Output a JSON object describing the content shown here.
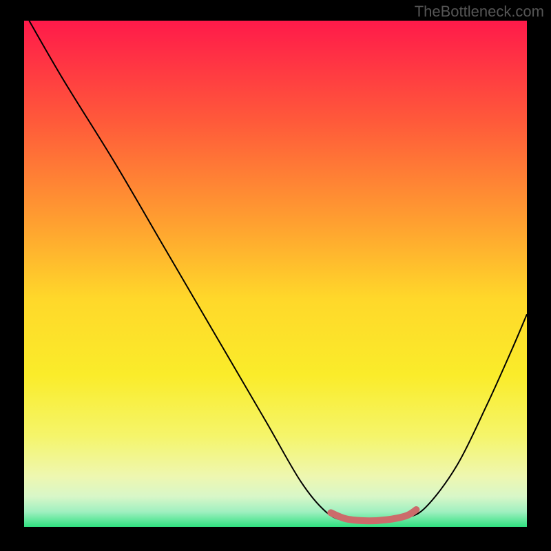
{
  "watermark": "TheBottleneck.com",
  "chart_data": {
    "type": "line",
    "title": "",
    "xlabel": "",
    "ylabel": "",
    "xlim": [
      0,
      100
    ],
    "ylim": [
      0,
      100
    ],
    "gradient_stops": [
      {
        "offset": 0,
        "color": "#ff1a4a"
      },
      {
        "offset": 20,
        "color": "#ff5a3a"
      },
      {
        "offset": 40,
        "color": "#ffa030"
      },
      {
        "offset": 55,
        "color": "#ffd82a"
      },
      {
        "offset": 70,
        "color": "#faec2a"
      },
      {
        "offset": 82,
        "color": "#f5f56a"
      },
      {
        "offset": 90,
        "color": "#eef7b0"
      },
      {
        "offset": 94,
        "color": "#d8f7c8"
      },
      {
        "offset": 97,
        "color": "#a0f0c0"
      },
      {
        "offset": 100,
        "color": "#30e080"
      }
    ],
    "series": [
      {
        "name": "bottleneck-curve",
        "color": "#000000",
        "width": 2,
        "points": [
          {
            "x": 1,
            "y": 100
          },
          {
            "x": 8,
            "y": 88
          },
          {
            "x": 18,
            "y": 72
          },
          {
            "x": 28,
            "y": 55
          },
          {
            "x": 38,
            "y": 38
          },
          {
            "x": 48,
            "y": 21
          },
          {
            "x": 55,
            "y": 9
          },
          {
            "x": 60,
            "y": 3
          },
          {
            "x": 64,
            "y": 1.2
          },
          {
            "x": 70,
            "y": 1.0
          },
          {
            "x": 76,
            "y": 1.8
          },
          {
            "x": 80,
            "y": 4
          },
          {
            "x": 86,
            "y": 12
          },
          {
            "x": 92,
            "y": 24
          },
          {
            "x": 97,
            "y": 35
          },
          {
            "x": 100,
            "y": 42
          }
        ]
      },
      {
        "name": "highlight-band",
        "color": "#cc6b6b",
        "width": 10,
        "points": [
          {
            "x": 61,
            "y": 2.8
          },
          {
            "x": 64,
            "y": 1.6
          },
          {
            "x": 68,
            "y": 1.2
          },
          {
            "x": 72,
            "y": 1.4
          },
          {
            "x": 76,
            "y": 2.2
          },
          {
            "x": 78,
            "y": 3.4
          }
        ]
      }
    ]
  }
}
